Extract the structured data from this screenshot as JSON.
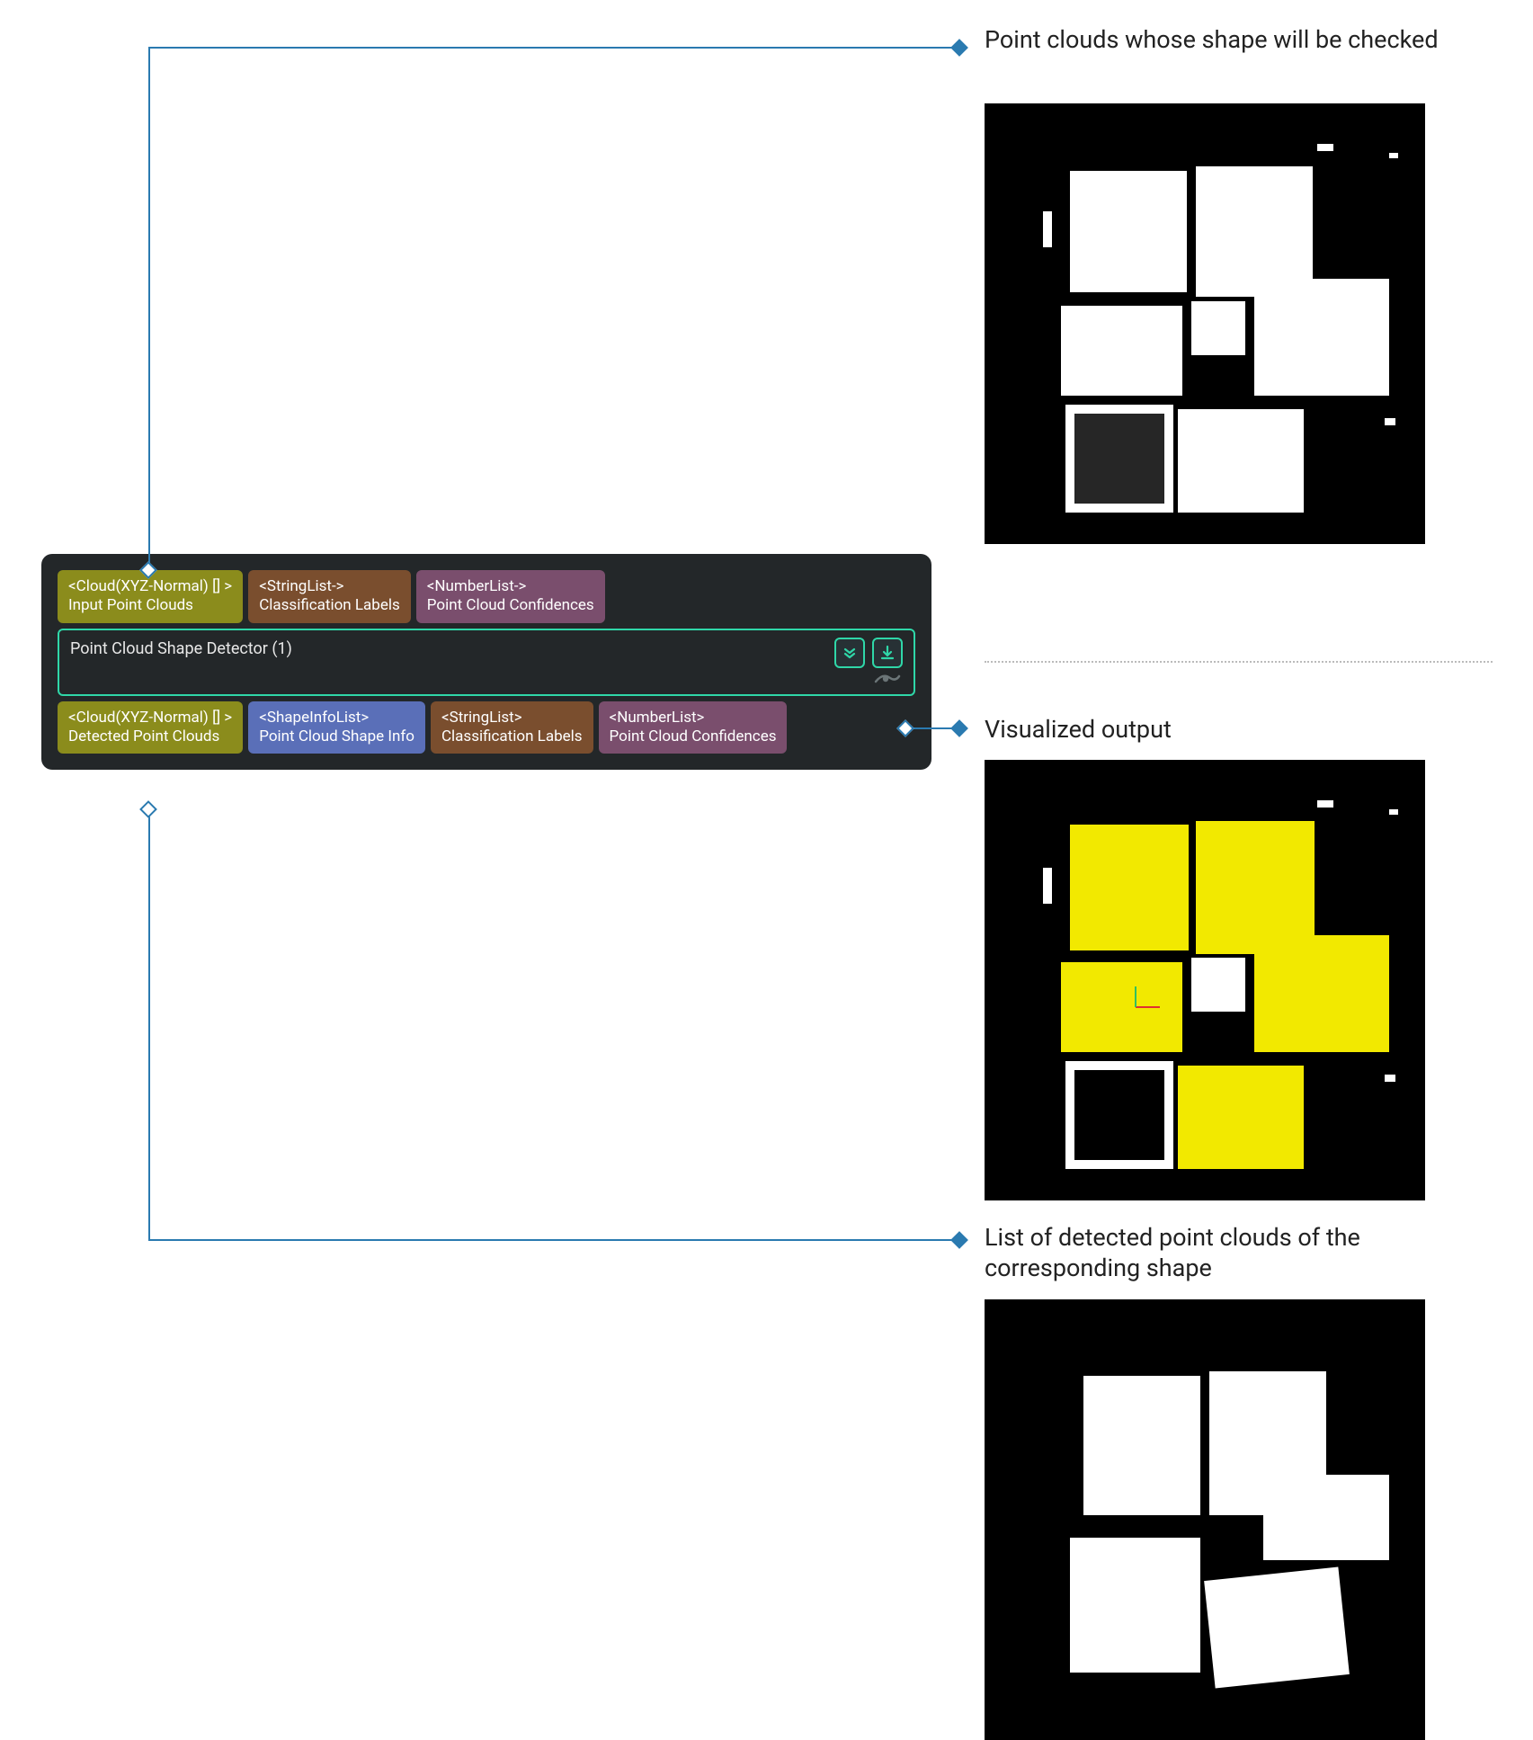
{
  "annotations": {
    "input_caption": "Point clouds whose shape will be checked",
    "visualized_caption": "Visualized output",
    "detected_caption": "List of detected point clouds of the corresponding shape"
  },
  "node": {
    "title": "Point Cloud Shape Detector (1)",
    "inputs": [
      {
        "type": "<Cloud(XYZ-Normal) [] >",
        "label": "Input Point Clouds",
        "color": "olive"
      },
      {
        "type": "<StringList->",
        "label": "Classification Labels",
        "color": "brown"
      },
      {
        "type": "<NumberList->",
        "label": "Point Cloud Confidences",
        "color": "purple"
      }
    ],
    "outputs": [
      {
        "type": "<Cloud(XYZ-Normal) [] >",
        "label": "Detected Point Clouds",
        "color": "olive"
      },
      {
        "type": "<ShapeInfoList>",
        "label": "Point Cloud Shape Info",
        "color": "indigo"
      },
      {
        "type": "<StringList>",
        "label": "Classification Labels",
        "color": "brown"
      },
      {
        "type": "<NumberList>",
        "label": "Point Cloud Confidences",
        "color": "purple"
      }
    ]
  },
  "connectors": {
    "line_color": "#2a7ab0"
  }
}
